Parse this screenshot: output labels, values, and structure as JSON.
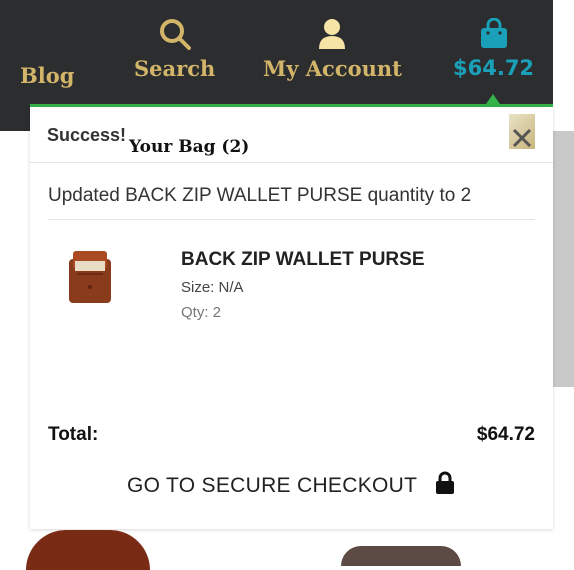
{
  "nav": {
    "blog": "Blog",
    "search": "Search",
    "account": "My Account",
    "bag_total": "$64.72"
  },
  "panel": {
    "success": "Success!",
    "bag_title": "Your Bag (2)",
    "message": "Updated BACK ZIP WALLET PURSE quantity to 2",
    "close_icon": "close-icon",
    "item": {
      "name": "BACK ZIP WALLET PURSE",
      "size": "Size: N/A",
      "qty": "Qty: 2"
    },
    "total_label": "Total:",
    "total_value": "$64.72",
    "checkout": "GO TO SECURE CHECKOUT"
  },
  "colors": {
    "topbar": "#2b2d2f",
    "nav_gold": "#d3b56a",
    "bag_teal": "#1aa0b8",
    "accent_green": "#34b24a"
  }
}
